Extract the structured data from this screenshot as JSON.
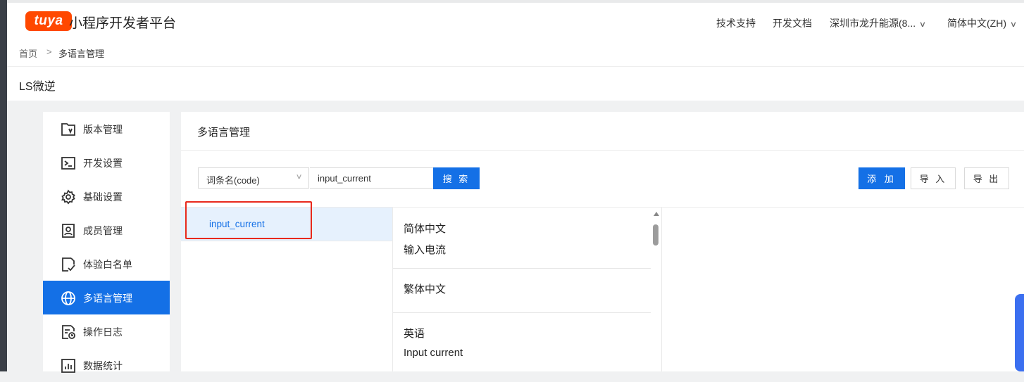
{
  "header": {
    "logo_text": "tuya",
    "title": "小程序开发者平台",
    "nav": {
      "tech_support": "技术支持",
      "dev_docs": "开发文档",
      "account": "深圳市龙升能源(8...",
      "language": "简体中文(ZH)"
    },
    "colors": {
      "logo_bg": "#ff4800"
    }
  },
  "breadcrumb": {
    "home": "首页",
    "separator": ">",
    "current": "多语言管理"
  },
  "app": {
    "name": "LS微逆"
  },
  "sidebar": {
    "items": [
      {
        "label": "版本管理",
        "icon": "version-icon"
      },
      {
        "label": "开发设置",
        "icon": "terminal-icon"
      },
      {
        "label": "基础设置",
        "icon": "gear-icon"
      },
      {
        "label": "成员管理",
        "icon": "member-icon"
      },
      {
        "label": "体验白名单",
        "icon": "whitelist-icon"
      },
      {
        "label": "多语言管理",
        "icon": "globe-icon",
        "active": true
      },
      {
        "label": "操作日志",
        "icon": "log-icon"
      },
      {
        "label": "数据统计",
        "icon": "chart-icon"
      }
    ]
  },
  "main": {
    "title": "多语言管理",
    "search": {
      "field_select": "词条名(code)",
      "value": "input_current",
      "button": "搜 索"
    },
    "actions": {
      "add": "添 加",
      "import": "导 入",
      "export": "导 出"
    },
    "keys": [
      "input_current"
    ],
    "translations": [
      {
        "lang": "简体中文",
        "text": "输入电流"
      },
      {
        "lang": "繁体中文",
        "text": ""
      },
      {
        "lang": "英语",
        "text": "Input current"
      }
    ],
    "colors": {
      "primary": "#1470e6",
      "highlight_border": "#e8291c"
    }
  }
}
